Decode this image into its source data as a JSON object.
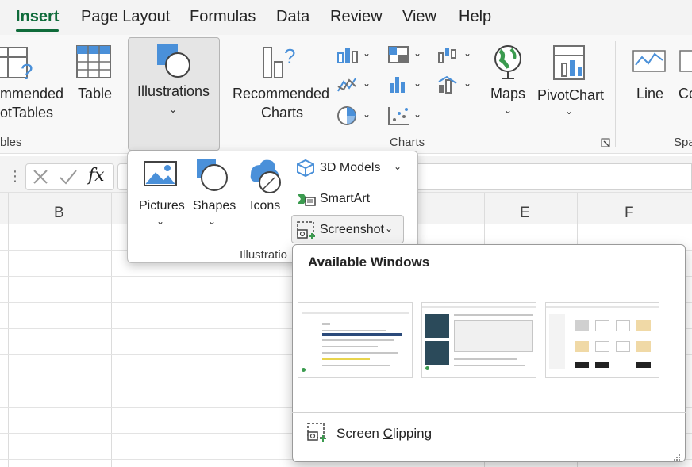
{
  "menu": {
    "tabs": [
      {
        "label": "Insert",
        "active": true
      },
      {
        "label": "Page Layout"
      },
      {
        "label": "Formulas"
      },
      {
        "label": "Data"
      },
      {
        "label": "Review"
      },
      {
        "label": "View"
      },
      {
        "label": "Help"
      }
    ]
  },
  "ribbon": {
    "pivot_label_1": "mmended",
    "pivot_label_2": "otTables",
    "table_label": "Table",
    "tables_group": "bles",
    "illustrations_label": "Illustrations",
    "rec_charts_1": "Recommended",
    "rec_charts_2": "Charts",
    "maps_label": "Maps",
    "pivotchart_label": "PivotChart",
    "charts_group": "Charts",
    "line_label": "Line",
    "col_label": "Co",
    "spark_group": "Spa"
  },
  "formula_bar": {
    "fx": "fx",
    "value": ""
  },
  "grid": {
    "columns": [
      "B",
      "E",
      "F"
    ]
  },
  "illustrations_menu": {
    "pictures": "Pictures",
    "shapes": "Shapes",
    "icons": "Icons",
    "models_3d": "3D Models",
    "smartart": "SmartArt",
    "screenshot": "Screenshot",
    "group_label": "Illustratio"
  },
  "screenshot_gallery": {
    "title": "Available Windows",
    "screen_clipping": "Screen Clipping",
    "screen_clipping_access_key": "C"
  },
  "colors": {
    "accent": "#0f6b3a",
    "chart_blue": "#4a90d9",
    "icon_gray": "#707070"
  }
}
